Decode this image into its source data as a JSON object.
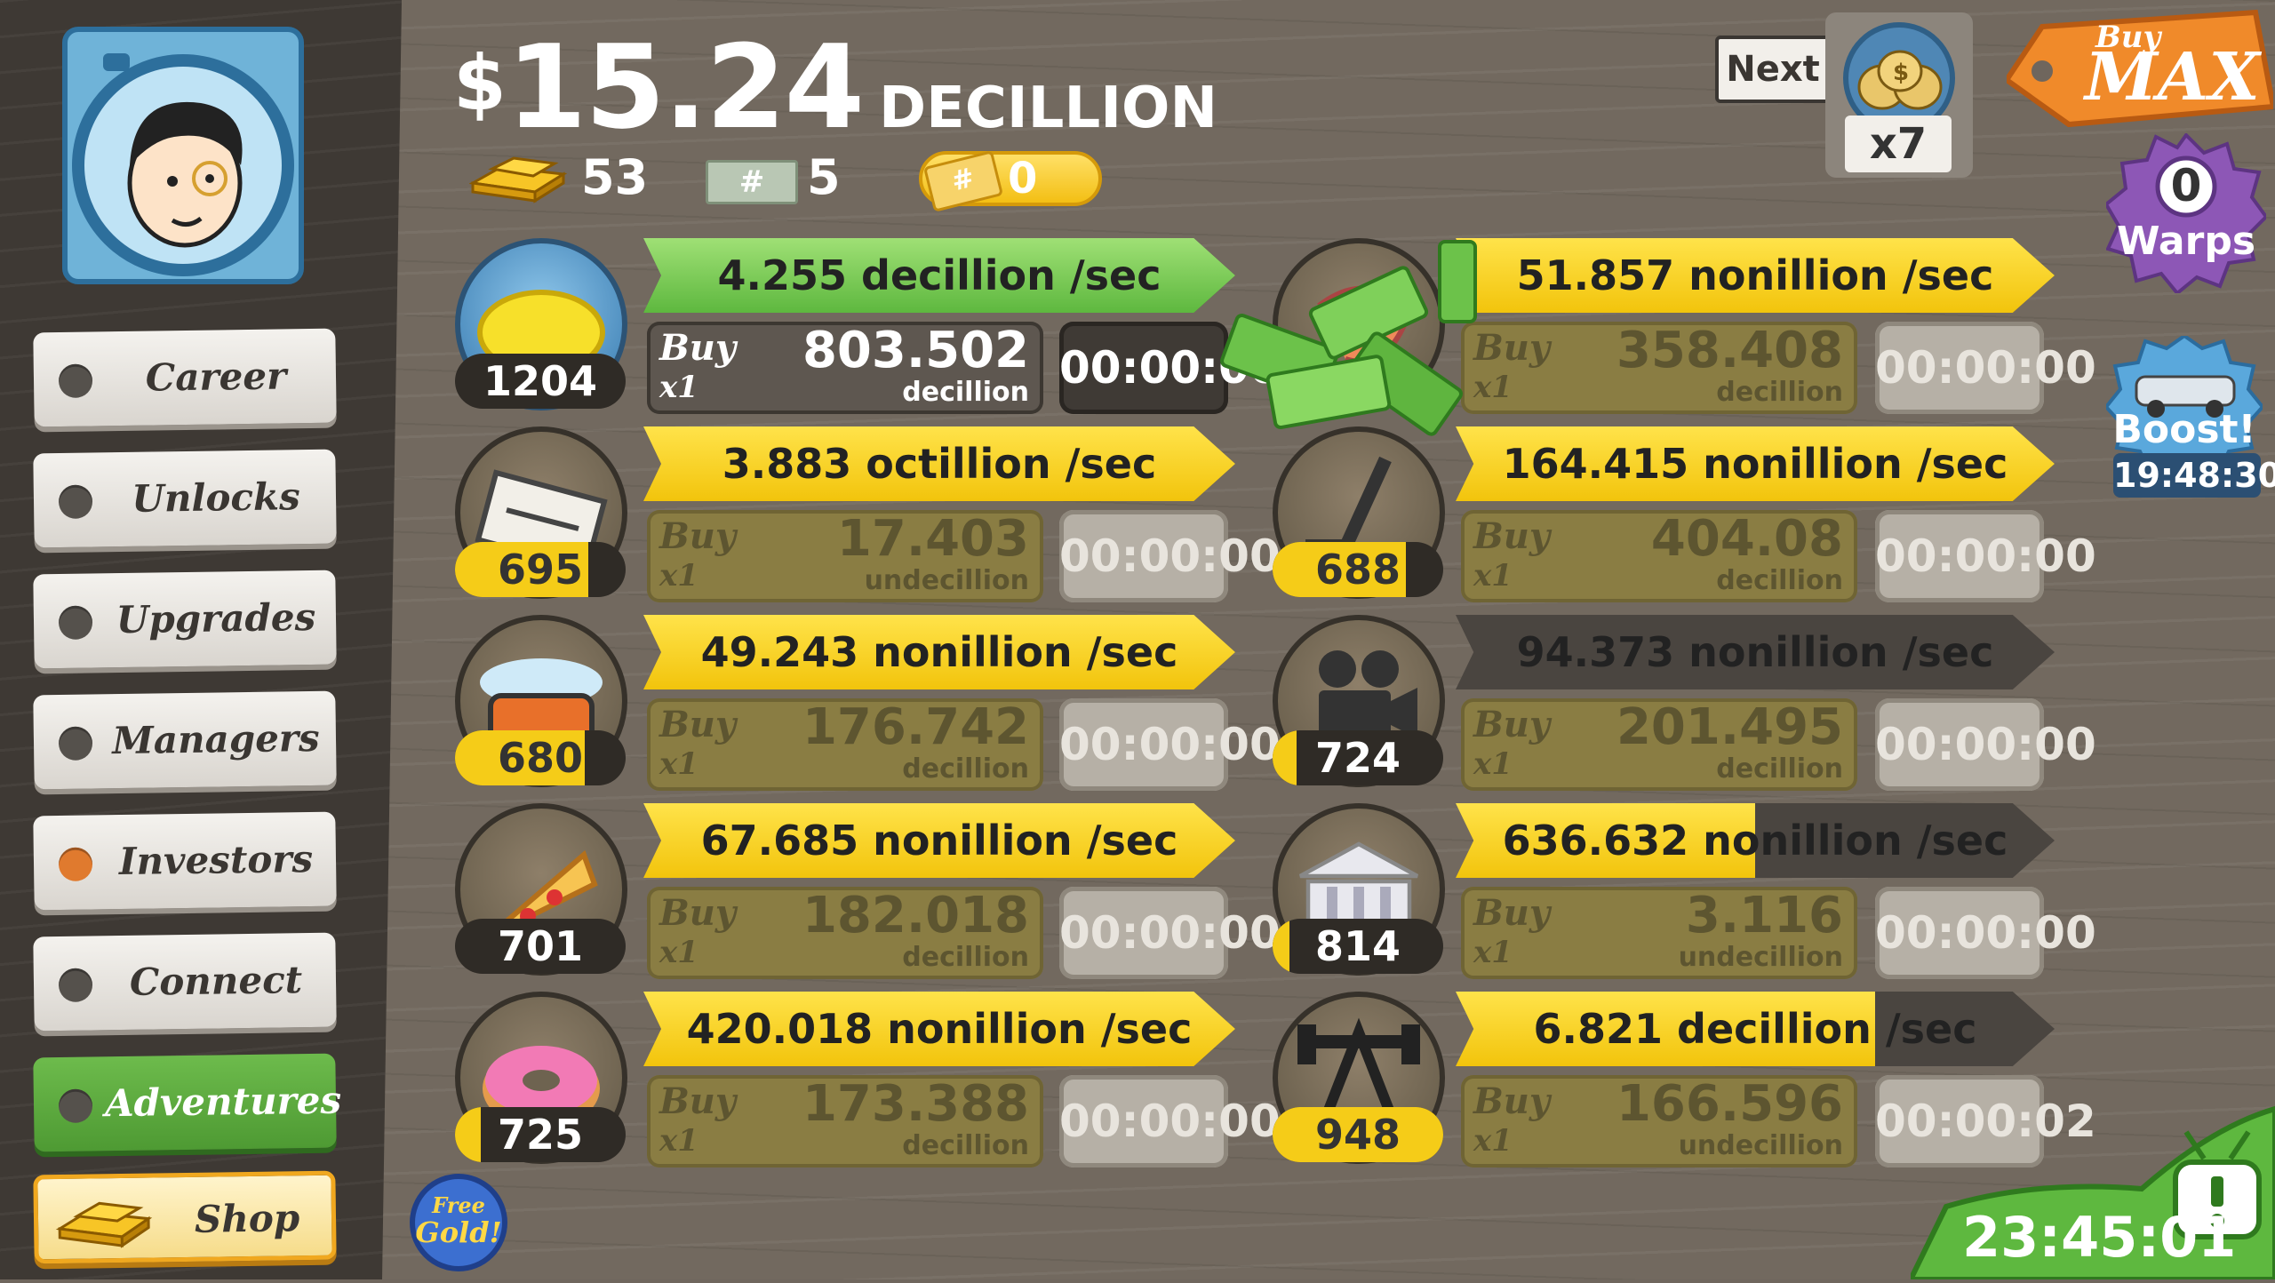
{
  "header": {
    "currency_symbol": "$",
    "amount": "15.24",
    "unit": "DECILLION",
    "gold_count": "53",
    "megabucks_count": "5",
    "megaticket_count": "0"
  },
  "sidebar": {
    "items": [
      {
        "label": "Career",
        "dot": "#55514c"
      },
      {
        "label": "Unlocks",
        "dot": "#55514c"
      },
      {
        "label": "Upgrades",
        "dot": "#55514c"
      },
      {
        "label": "Managers",
        "dot": "#55514c"
      },
      {
        "label": "Investors",
        "dot": "#e07a2e"
      },
      {
        "label": "Connect",
        "dot": "#55514c"
      },
      {
        "label": "Adventures",
        "dot": "#55514c"
      }
    ],
    "shop_label": "Shop"
  },
  "unlock_widget": {
    "next_label": "Next",
    "multiplier": "x7"
  },
  "buy_max": {
    "line1": "Buy",
    "line2": "MAX"
  },
  "warps": {
    "count": "0",
    "label": "Warps"
  },
  "boost": {
    "label": "Boost!",
    "time": "19:48:30"
  },
  "bottom_timer": "23:45:01",
  "free_gold": {
    "line1": "Free",
    "line2": "Gold!"
  },
  "ventures_left": [
    {
      "icon": "lemon-icon",
      "count": "1204",
      "count_fill": 0.0,
      "rate": "4.255 decillion /sec",
      "rate_fill": 1.0,
      "green": true,
      "buy": "Buy",
      "mult": "x1",
      "price": "803.502",
      "price_unit": "decillion",
      "timer": "00:00:00",
      "active": true
    },
    {
      "icon": "newspaper-icon",
      "count": "695",
      "count_fill": 0.78,
      "rate": "3.883 octillion /sec",
      "rate_fill": 1.0,
      "green": false,
      "buy": "Buy",
      "mult": "x1",
      "price": "17.403",
      "price_unit": "undecillion",
      "timer": "00:00:00",
      "active": false
    },
    {
      "icon": "car-wash-icon",
      "count": "680",
      "count_fill": 0.76,
      "rate": "49.243 nonillion /sec",
      "rate_fill": 1.0,
      "green": false,
      "buy": "Buy",
      "mult": "x1",
      "price": "176.742",
      "price_unit": "decillion",
      "timer": "00:00:00",
      "active": false
    },
    {
      "icon": "pizza-icon",
      "count": "701",
      "count_fill": 0.0,
      "rate": "67.685 nonillion /sec",
      "rate_fill": 1.0,
      "green": false,
      "buy": "Buy",
      "mult": "x1",
      "price": "182.018",
      "price_unit": "decillion",
      "timer": "00:00:00",
      "active": false
    },
    {
      "icon": "donut-icon",
      "count": "725",
      "count_fill": 0.15,
      "rate": "420.018 nonillion /sec",
      "rate_fill": 1.0,
      "green": false,
      "buy": "Buy",
      "mult": "x1",
      "price": "173.388",
      "price_unit": "decillion",
      "timer": "00:00:00",
      "active": false
    }
  ],
  "ventures_right": [
    {
      "icon": "shrimp-icon",
      "count": "",
      "count_fill": 0.0,
      "rate": "51.857 nonillion /sec",
      "rate_fill": 1.0,
      "green": false,
      "buy": "Buy",
      "mult": "x1",
      "price": "358.408",
      "price_unit": "decillion",
      "timer": "00:00:00",
      "active": false
    },
    {
      "icon": "hockey-stick-icon",
      "count": "688",
      "count_fill": 0.78,
      "rate": "164.415 nonillion /sec",
      "rate_fill": 1.0,
      "green": false,
      "buy": "Buy",
      "mult": "x1",
      "price": "404.08",
      "price_unit": "decillion",
      "timer": "00:00:00",
      "active": false
    },
    {
      "icon": "movie-camera-icon",
      "count": "724",
      "count_fill": 0.14,
      "rate": "94.373 nonillion /sec",
      "rate_fill": 0.0,
      "green": false,
      "buy": "Buy",
      "mult": "x1",
      "price": "201.495",
      "price_unit": "decillion",
      "timer": "00:00:00",
      "active": false
    },
    {
      "icon": "bank-icon",
      "count": "814",
      "count_fill": 0.1,
      "rate": "636.632 nonillion /sec",
      "rate_fill": 0.5,
      "green": false,
      "buy": "Buy",
      "mult": "x1",
      "price": "3.116",
      "price_unit": "undecillion",
      "timer": "00:00:00",
      "active": false
    },
    {
      "icon": "oil-rig-icon",
      "count": "948",
      "count_fill": 1.0,
      "rate": "6.821 decillion /sec",
      "rate_fill": 0.7,
      "green": false,
      "buy": "Buy",
      "mult": "x1",
      "price": "166.596",
      "price_unit": "undecillion",
      "timer": "00:00:02",
      "active": false
    }
  ]
}
